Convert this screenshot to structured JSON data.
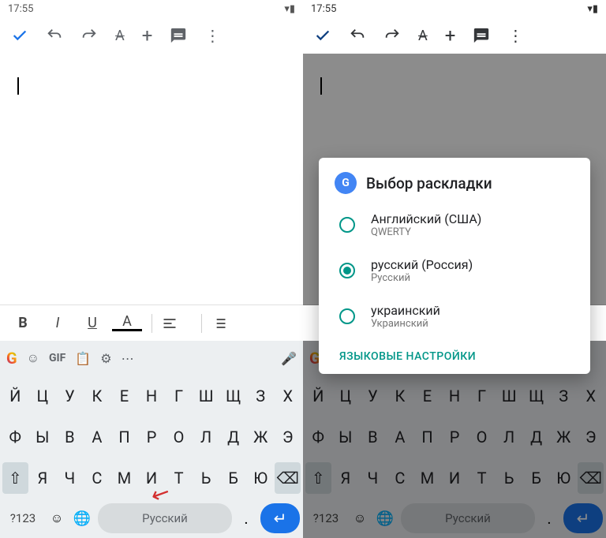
{
  "status": {
    "time": "17:55"
  },
  "toolbar_icons": [
    "check",
    "undo",
    "redo",
    "text-format",
    "plus",
    "comment",
    "more"
  ],
  "fmt": {
    "bold": "B",
    "italic": "I",
    "underline": "U",
    "color": "A"
  },
  "kbd": {
    "row1": [
      "Й",
      "Ц",
      "У",
      "К",
      "Е",
      "Н",
      "Г",
      "Ш",
      "Щ",
      "З",
      "Х"
    ],
    "row2": [
      "Ф",
      "Ы",
      "В",
      "А",
      "П",
      "Р",
      "О",
      "Л",
      "Д",
      "Ж",
      "Э"
    ],
    "row3": [
      "Я",
      "Ч",
      "С",
      "М",
      "И",
      "Т",
      "Ь",
      "Б",
      "Ю"
    ],
    "gif": "GIF",
    "q123": "?123",
    "space": "Русский",
    "dot": "."
  },
  "dialog": {
    "title": "Выбор раскладки",
    "items": [
      {
        "title": "Английский (США)",
        "sub": "QWERTY",
        "selected": false
      },
      {
        "title": "русский (Россия)",
        "sub": "Русский",
        "selected": true
      },
      {
        "title": "украинский",
        "sub": "Украинский",
        "selected": false
      }
    ],
    "link": "ЯЗЫКОВЫЕ НАСТРОЙКИ"
  }
}
